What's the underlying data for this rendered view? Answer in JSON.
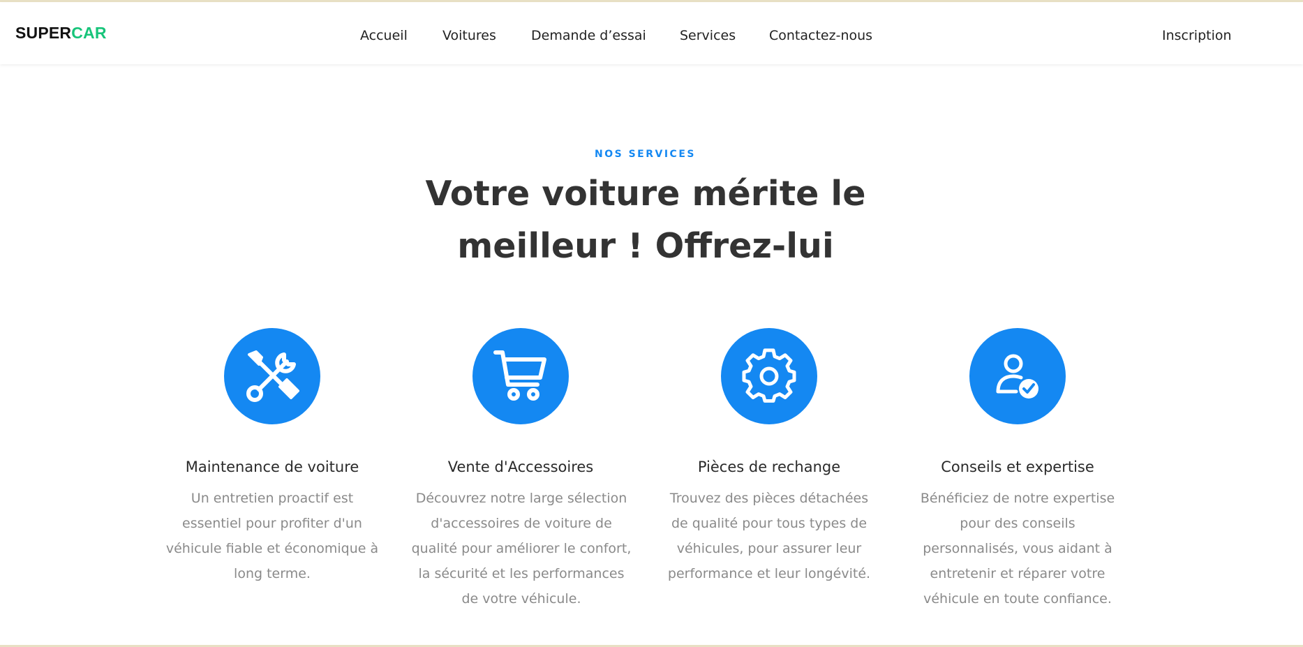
{
  "colors": {
    "accent": "#1488f2",
    "logo_green": "#17c47a",
    "text_dark": "#333333",
    "text_muted": "#8a8a8a"
  },
  "header": {
    "logo_part1": "SUPER",
    "logo_part2": "CAR",
    "nav": [
      {
        "label": "Accueil"
      },
      {
        "label": "Voitures"
      },
      {
        "label": "Demande d’essai"
      },
      {
        "label": "Services"
      },
      {
        "label": "Contactez-nous"
      }
    ],
    "signup_label": "Inscription"
  },
  "hero": {
    "tag": "NOS SERVICES",
    "title": "Votre voiture mérite le meilleur ! Offrez-lui"
  },
  "services": [
    {
      "icon": "tools-icon",
      "title": "Maintenance de voiture",
      "description": "Un entretien proactif est essentiel pour profiter d'un véhicule fiable et économique à long terme."
    },
    {
      "icon": "shopping-cart-icon",
      "title": "Vente d'Accessoires",
      "description": "Découvrez notre large sélection d'accessoires de voiture de qualité pour améliorer le confort, la sécurité et les performances de votre véhicule."
    },
    {
      "icon": "gear-icon",
      "title": "Pièces de rechange",
      "description": "Trouvez des pièces détachées de qualité pour tous types de véhicules, pour assurer leur performance et leur longévité."
    },
    {
      "icon": "user-check-icon",
      "title": "Conseils et expertise",
      "description": "Bénéficiez de notre expertise pour des conseils personnalisés, vous aidant à entretenir et réparer votre véhicule en toute confiance."
    }
  ]
}
